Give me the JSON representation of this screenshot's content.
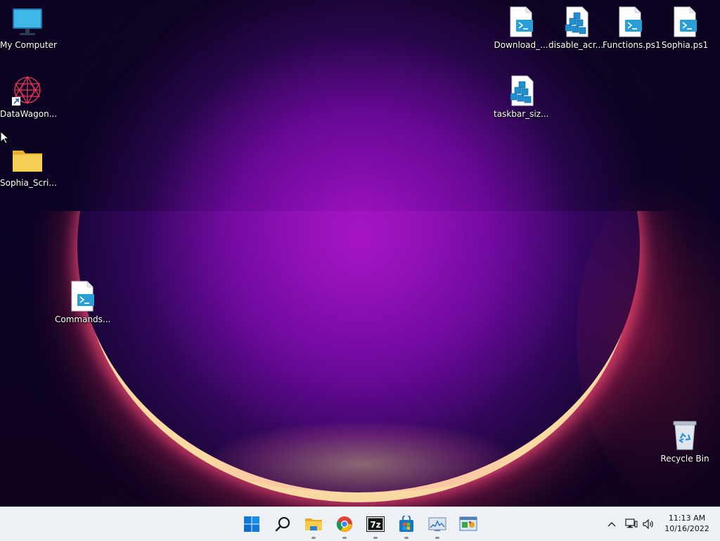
{
  "desktop_icons": [
    {
      "label": "My Computer",
      "icon": "monitor-icon"
    },
    {
      "label": "DataWagon...",
      "icon": "datawagon-shortcut-icon"
    },
    {
      "label": "Sophia_Scri...",
      "icon": "folder-icon"
    },
    {
      "label": "Commands...",
      "icon": "powershell-script-icon"
    },
    {
      "label": "Download_...",
      "icon": "powershell-script-icon"
    },
    {
      "label": "disable_acr...",
      "icon": "registry-file-icon"
    },
    {
      "label": "Functions.ps1",
      "icon": "powershell-script-icon"
    },
    {
      "label": "Sophia.ps1",
      "icon": "powershell-script-icon"
    },
    {
      "label": "taskbar_siz...",
      "icon": "registry-file-icon"
    },
    {
      "label": "Recycle Bin",
      "icon": "recycle-bin-icon"
    }
  ],
  "taskbar": {
    "apps": [
      {
        "name": "Start",
        "icon": "windows-start-icon"
      },
      {
        "name": "Search",
        "icon": "search-icon"
      },
      {
        "name": "File Explorer",
        "icon": "file-explorer-icon"
      },
      {
        "name": "Google Chrome",
        "icon": "chrome-icon"
      },
      {
        "name": "7-Zip",
        "icon": "7zip-icon"
      },
      {
        "name": "Microsoft Store",
        "icon": "store-icon"
      },
      {
        "name": "Resource Monitor",
        "icon": "resource-monitor-icon"
      },
      {
        "name": "Control Panel",
        "icon": "control-panel-icon"
      }
    ],
    "tray": {
      "time": "11:13 AM",
      "date": "10/16/2022"
    }
  },
  "colors": {
    "taskbar_bg": "#eef1f6",
    "ps_blue": "#2a9fd6",
    "folder_yellow": "#f6c744"
  }
}
